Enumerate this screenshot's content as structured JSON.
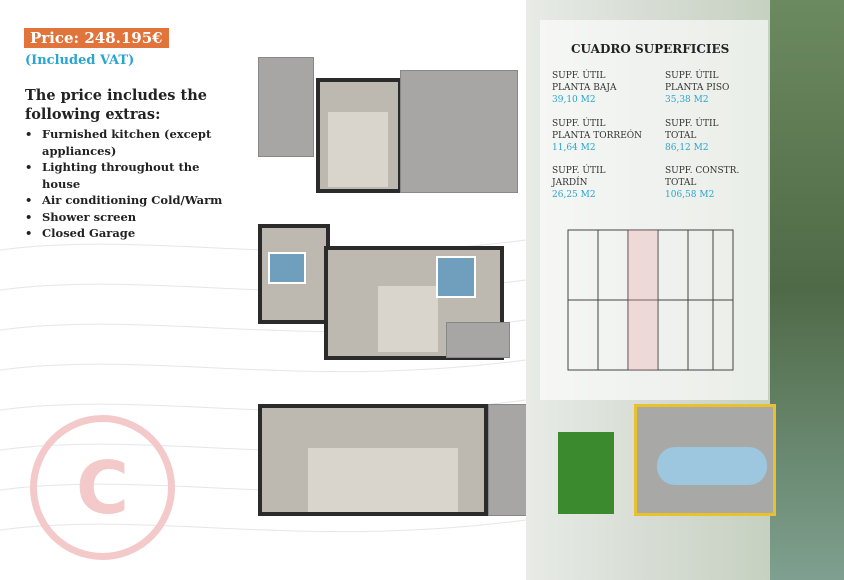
{
  "price": {
    "label": "Price: 248.195€",
    "vat": "(Included VAT)"
  },
  "extras": {
    "heading": "The price includes the following extras:",
    "items": [
      "Furnished kitchen (except appliances)",
      "Lighting throughout the house",
      "Air conditioning Cold/Warm",
      "Shower screen",
      "Closed Garage"
    ]
  },
  "surfaces": {
    "title": "CUADRO SUPERFICIES",
    "cells": [
      {
        "label1": "SUPF. ÚTIL",
        "label2": "PLANTA BAJA",
        "value": "39,10 M2"
      },
      {
        "label1": "SUPF. ÚTIL",
        "label2": "PLANTA PISO",
        "value": "35,38 M2"
      },
      {
        "label1": "SUPF. ÚTIL",
        "label2": "PLANTA TORREÓN",
        "value": "11,64 M2"
      },
      {
        "label1": "SUPF. ÚTIL",
        "label2": "TOTAL",
        "value": "86,12 M2"
      },
      {
        "label1": "SUPF. ÚTIL",
        "label2": "JARDÍN",
        "value": "26,25 M2"
      },
      {
        "label1": "SUPF. CONSTR.",
        "label2": "TOTAL",
        "value": "106,58 M2"
      }
    ]
  },
  "watermark": "C",
  "colors": {
    "price_bg": "#e0743a",
    "accent": "#2aa5d0"
  }
}
